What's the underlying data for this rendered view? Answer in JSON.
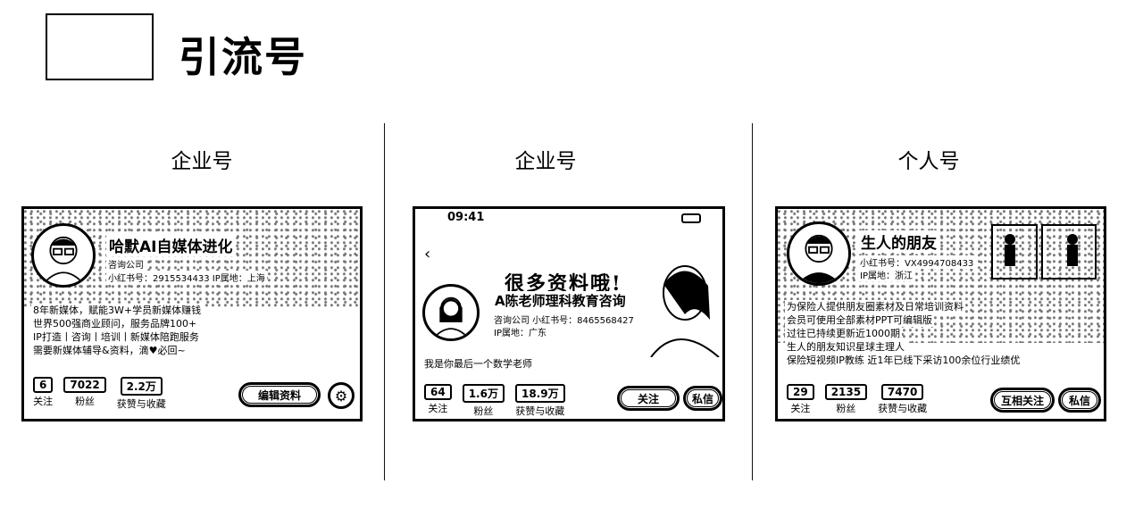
{
  "page": {
    "title": "引流号"
  },
  "columns": [
    {
      "label": "企业号",
      "profile": {
        "name": "哈默AI自媒体进化",
        "type": "咨询公司",
        "id_line": "小红书号：2915534433  IP属地：上海",
        "bio": [
          "8年新媒体，赋能3W+学员新媒体赚钱",
          "世界500强商业顾问，服务品牌100+",
          "IP打造丨咨询丨培训丨新媒体陪跑服务",
          "需要新媒体辅导&资料，滴♥必回~"
        ],
        "stats": [
          {
            "value": "6",
            "label": "关注"
          },
          {
            "value": "7022",
            "label": "粉丝"
          },
          {
            "value": "2.2万",
            "label": "获赞与收藏"
          }
        ],
        "button": "编辑资料",
        "settings_icon": "gear-icon"
      }
    },
    {
      "label": "企业号",
      "profile": {
        "time": "09:41",
        "banner_text": "很多资料哦!",
        "name": "A陈老师理科教育咨询",
        "id_line": "咨询公司  小红书号：8465568427",
        "location": "IP属地：广东",
        "bio": [
          "我是你最后一个数学老师"
        ],
        "stats": [
          {
            "value": "64",
            "label": "关注"
          },
          {
            "value": "1.6万",
            "label": "粉丝"
          },
          {
            "value": "18.9万",
            "label": "获赞与收藏"
          }
        ],
        "button_follow": "关注",
        "button_message": "私信"
      }
    },
    {
      "label": "个人号",
      "profile": {
        "name": "生人的朋友",
        "id_line": "小红书号：VX4994708433",
        "location": "IP属地：浙江",
        "bio": [
          "为保险人提供朋友圈素材及日常培训资料",
          "会员可使用全部素材PPT可编辑版",
          "过往已持续更新近1000期",
          "生人的朋友知识星球主理人",
          "保险短视频IP教练  近1年已线下采访100余位行业绩优"
        ],
        "stats": [
          {
            "value": "29",
            "label": "关注"
          },
          {
            "value": "2135",
            "label": "粉丝"
          },
          {
            "value": "7470",
            "label": "获赞与收藏"
          }
        ],
        "button_follow": "互相关注",
        "button_message": "私信"
      }
    }
  ]
}
